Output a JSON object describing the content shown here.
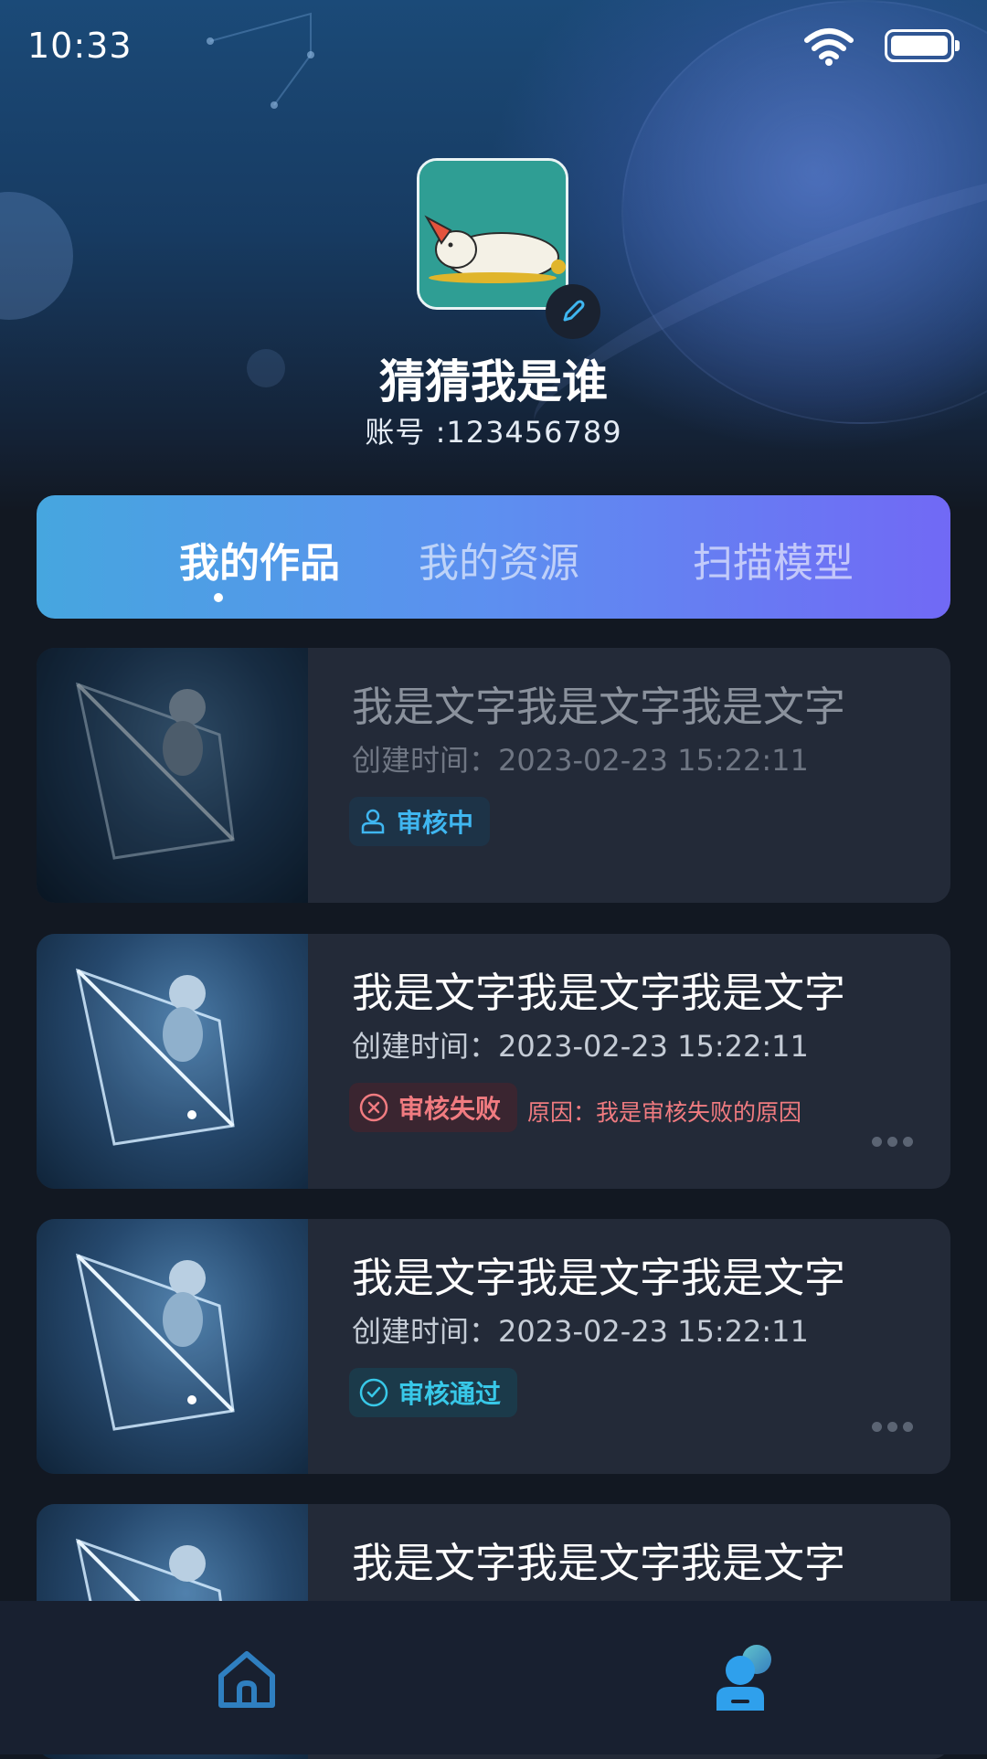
{
  "status_bar": {
    "time": "10:33"
  },
  "profile": {
    "username": "猜猜我是谁",
    "account": "账号 :123456789"
  },
  "tabs": [
    {
      "label": "我的作品",
      "active": true
    },
    {
      "label": "我的资源",
      "active": false
    },
    {
      "label": "扫描模型",
      "active": false
    }
  ],
  "works": [
    {
      "title": "我是文字我是文字我是文字",
      "date": "创建时间：2023-02-23 15:22:11",
      "status": "审核中",
      "status_icon": "reviewer-icon",
      "reason": ""
    },
    {
      "title": "我是文字我是文字我是文字",
      "date": "创建时间：2023-02-23 15:22:11",
      "status": "审核失败",
      "status_icon": "close-circle-icon",
      "reason": "原因：我是审核失败的原因"
    },
    {
      "title": "我是文字我是文字我是文字",
      "date": "创建时间：2023-02-23 15:22:11",
      "status": "审核通过",
      "status_icon": "check-circle-icon",
      "reason": ""
    },
    {
      "title": "我是文字我是文字我是文字",
      "date": "",
      "status": "",
      "status_icon": "",
      "reason": ""
    }
  ],
  "colors": {
    "tab_gradient_start": "#46a6df",
    "tab_gradient_end": "#7169f5",
    "review": "#3fb6f0",
    "fail": "#f07b80",
    "pass": "#38c8e8"
  },
  "bottom_nav": {
    "items": [
      "home-icon",
      "profile-icon"
    ],
    "active": "profile-icon"
  }
}
